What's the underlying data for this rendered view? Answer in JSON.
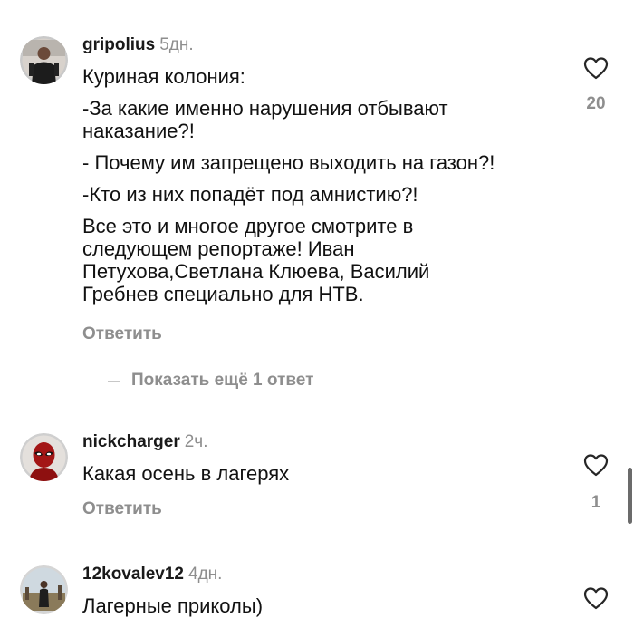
{
  "colors": {
    "text": "#111111",
    "secondary": "#8e8e8e",
    "background": "#ffffff",
    "divider": "#c7c7c7"
  },
  "comments": [
    {
      "username": "gripolius",
      "time": "5дн.",
      "paragraphs": [
        "Куриная колония:",
        "-За какие именно нарушения отбывают наказание?!",
        "- Почему им запрещено выходить на газон?!",
        "-Кто из них попадёт под амнистию?!",
        "Все это и многое другое смотрите в следующем репортаже! Иван Петухова,Светлана Клюева, Василий Гребнев специально для НТВ."
      ],
      "reply_label": "Ответить",
      "likes": "20",
      "avatar_icon": "person-avatar-icon",
      "like_icon": "heart-outline-icon"
    },
    {
      "username": "nickcharger",
      "time": "2ч.",
      "paragraphs": [
        "Какая осень в лагерях"
      ],
      "reply_label": "Ответить",
      "likes": "1",
      "avatar_icon": "masked-hero-avatar-icon",
      "like_icon": "heart-outline-icon"
    },
    {
      "username": "12kovalev12",
      "time": "4дн.",
      "paragraphs": [
        "Лагерные приколы)"
      ],
      "avatar_icon": "person-outdoor-avatar-icon",
      "like_icon": "heart-outline-icon"
    }
  ],
  "show_more_replies": "Показать ещё 1 ответ"
}
